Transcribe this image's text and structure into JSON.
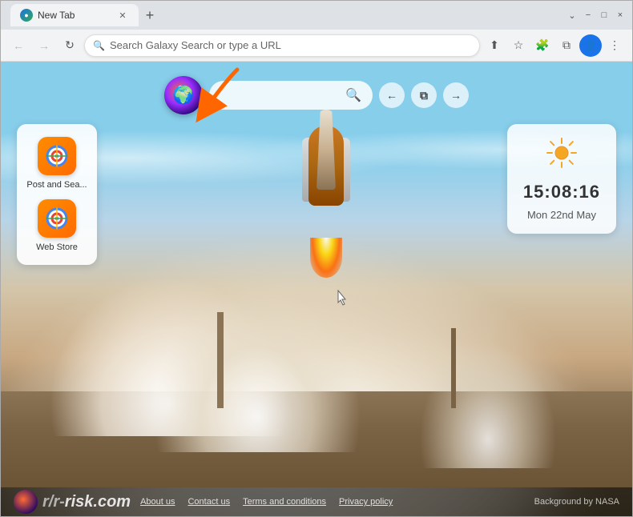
{
  "browser": {
    "tab": {
      "title": "New Tab",
      "favicon_color": "#1a73e8"
    },
    "toolbar": {
      "back_label": "←",
      "forward_label": "→",
      "reload_label": "↻",
      "address_placeholder": "Search Galaxy Search or type a URL",
      "share_icon": "share-icon",
      "bookmark_icon": "bookmark-icon",
      "extensions_icon": "extensions-icon",
      "tab_search_icon": "tab-search-icon",
      "profile_icon": "profile-icon",
      "menu_icon": "menu-icon"
    },
    "window_controls": {
      "minimize": "−",
      "maximize": "□",
      "close": "×"
    }
  },
  "page": {
    "search": {
      "placeholder": "",
      "search_icon": "🔍"
    },
    "nav_btns": {
      "back": "←",
      "gallery": "⧉",
      "forward": "→"
    },
    "shortcuts": [
      {
        "label": "Post and Sea...",
        "icon_type": "chrome"
      },
      {
        "label": "Web Store",
        "icon_type": "chrome"
      }
    ],
    "clock": {
      "time": "15:08:16",
      "date": "Mon 22nd May"
    },
    "footer": {
      "brand": "r/r-risk.com",
      "links": [
        "About us",
        "Contact us",
        "Terms and conditions",
        "Privacy policy"
      ],
      "bg_credit": "Background by NASA"
    }
  }
}
